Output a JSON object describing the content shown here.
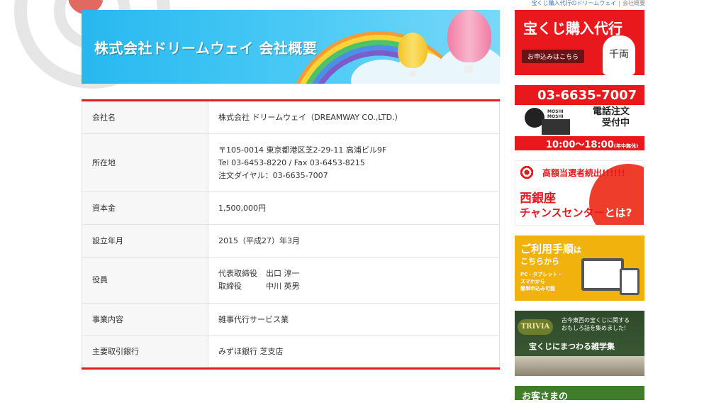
{
  "breadcrumb": {
    "home": "宝くじ購入代行のドリームウェイ",
    "separator": "|",
    "current": "会社概要"
  },
  "banner": {
    "title": "株式会社ドリームウェイ 会社概要"
  },
  "company": {
    "rows": [
      {
        "label": "会社名",
        "lines": [
          "株式会社 ドリームウェイ（DREAMWAY CO.,LTD.）"
        ]
      },
      {
        "label": "所在地",
        "lines": [
          "〒105-0014 東京都港区芝2-29-11 高浦ビル9F",
          "Tel 03-6453-8220 / Fax 03-6453-8215",
          "注文ダイヤル：03-6635-7007"
        ]
      },
      {
        "label": "資本金",
        "lines": [
          "1,500,000円"
        ]
      },
      {
        "label": "設立年月",
        "lines": [
          "2015（平成27）年3月"
        ]
      },
      {
        "label": "役員",
        "officers": [
          {
            "role": "代表取締役",
            "name": "出口 淳一"
          },
          {
            "role": "取締役",
            "name": "中川 英男"
          }
        ]
      },
      {
        "label": "事業内容",
        "lines": [
          "雑事代行サービス業"
        ]
      },
      {
        "label": "主要取引銀行",
        "lines": [
          "みずほ銀行 芝支店"
        ]
      }
    ]
  },
  "sidebar": {
    "b1": {
      "title": "宝くじ購入代行",
      "cta": "お申込みはこちら",
      "lucky_cat": "千両"
    },
    "b2": {
      "phone": "03-6635-7007",
      "l1": "電話注文",
      "l2": "受付中",
      "hours": "10:00〜18:00",
      "holiday": "(年中無休)",
      "m1": "MOSHI",
      "m2": "MOSHI"
    },
    "b3": {
      "t1": "高額当選者続出!!!!!!",
      "t2": "西銀座",
      "t3a": "チャンスセンター",
      "t3b": "とは?"
    },
    "b4": {
      "t1a": "ご利用手順",
      "t1b": "は",
      "t2": "こちらから",
      "l1": "PC・タブレット・",
      "l2": "スマホから",
      "l3": "簡単申込み可能"
    },
    "b5": {
      "logo": "TRIVIA",
      "l1": "古今東西の宝くじに関する",
      "l2": "おもしろ話を集めました!",
      "t2": "宝くじにまつわる雑学集"
    },
    "b6": {
      "t1": "お客さまの"
    }
  },
  "colors": {
    "accent": "#e01d22",
    "banner_blue": "#27b8ef",
    "label_bg": "#f7f7f7"
  }
}
